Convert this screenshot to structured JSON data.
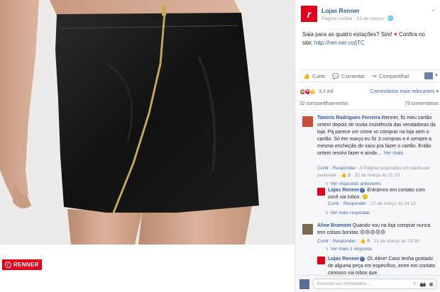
{
  "brand": {
    "logo_text": "RENNER"
  },
  "post": {
    "page_name": "Lojas Renner",
    "meta": "Página curtida · 21 de março · ",
    "text_part1": "Saia para as quatro estações? Sim! ",
    "text_part2": " Confira no site: ",
    "link": "http://ren-ner.co/jTC"
  },
  "actions": {
    "like": "Curtir",
    "comment": "Comentar",
    "share": "Compartilhar"
  },
  "reactions": {
    "count": "3,3 mil",
    "sort": "Comentários mais relevantes"
  },
  "stats": {
    "shares": "32 compartilhamentos",
    "comments": "73 comentários"
  },
  "comments": {
    "c1": {
      "name": "Tamiris Rodrigues Ferreira",
      "text": "Renner, fiz meu cartão ontem depois de muita insistência das vendadoras da loja. Pq parece um crime vc comprar na loja sem o cartão. Só em março eu fiz 3 compras e é sempre a mesma encheção do saco pra fazer o cartão. Então ontem resolvi fazer e ainda ...",
      "more": "Ver mais",
      "meta_curtir": "Curtir",
      "meta_responder": "Responder",
      "meta_replied": "· A Página respondeu em particular ·",
      "meta_count": "3",
      "meta_date": "· 22 de março às 11:19",
      "prev_replies": "Ver respostas anteriores"
    },
    "r1": {
      "name": "Lojas Renner",
      "text": "Entramos em contato com você via inbox.",
      "meta_curtir": "Curtir",
      "meta_responder": "Responder",
      "meta_date": "· 22 de março às 14:13",
      "more_replies": "Ver mais respostas"
    },
    "c2": {
      "name": "Aline Bramont",
      "text": "Quando vou na loja comprar nunca tem coisas bonitas",
      "meta_curtir": "Curtir",
      "meta_responder": "Responder",
      "meta_count": "9",
      "meta_date": "· 21 de março às 23:39",
      "more_reply": "Ver mais 1 resposta"
    },
    "r2": {
      "name": "Lojas Renner",
      "text": "Oi, Aline! Caso tenha gostado de alguma peça em específico, entre em contato conosco via inbox que"
    }
  },
  "write": {
    "placeholder": "Escreva um comentário..."
  },
  "colors": {
    "brand_red": "#e2001a",
    "fb_blue": "#4267b2",
    "name_blue": "#365899"
  }
}
